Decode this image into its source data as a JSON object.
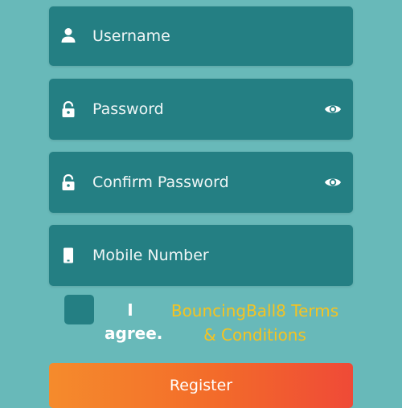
{
  "form": {
    "username": {
      "placeholder": "Username",
      "icon": "person-icon"
    },
    "password": {
      "placeholder": "Password",
      "icon": "lock-icon",
      "toggle_icon": "eye-icon"
    },
    "confirm_password": {
      "placeholder": "Confirm Password",
      "icon": "lock-icon",
      "toggle_icon": "eye-icon"
    },
    "mobile": {
      "placeholder": "Mobile Number",
      "icon": "phone-icon"
    }
  },
  "agreement": {
    "checked": false,
    "line1": "I",
    "line2": "agree.",
    "terms_link": "BouncingBall8 Terms & Conditions"
  },
  "register": {
    "label": "Register"
  },
  "colors": {
    "background": "#68b9b9",
    "field": "#247f83",
    "link": "#f6c320",
    "button_start": "#f58b2c",
    "button_end": "#ef4a37"
  }
}
